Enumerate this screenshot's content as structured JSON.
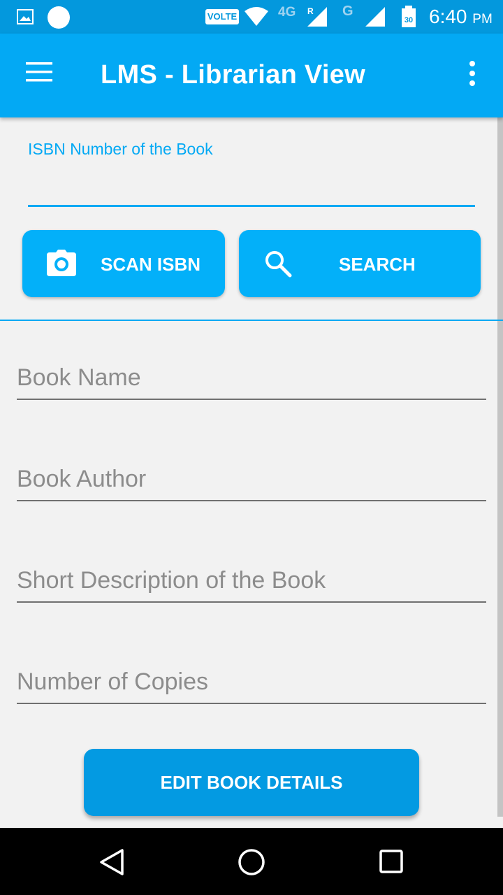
{
  "status_bar": {
    "volte": "VOLTE",
    "network_4g": "4G",
    "roaming": "R",
    "network_g": "G",
    "battery": "30",
    "time": "6:40",
    "ampm": "PM"
  },
  "app_bar": {
    "title": "LMS - Librarian View",
    "menu_icon": "hamburger-menu-icon",
    "overflow_icon": "more-vert-icon"
  },
  "isbn": {
    "label": "ISBN Number of the Book",
    "value": ""
  },
  "buttons": {
    "scan_label": "SCAN ISBN",
    "scan_icon": "camera-icon",
    "search_label": "SEARCH",
    "search_icon": "search-icon",
    "edit_label": "EDIT BOOK DETAILS"
  },
  "fields": {
    "book_name": "Book Name",
    "book_author": "Book Author",
    "short_description": "Short Description of the Book",
    "number_of_copies": "Number of Copies"
  },
  "colors": {
    "primary": "#03a9f4",
    "primary_dark": "#0398dd",
    "button": "#03b0f9"
  }
}
